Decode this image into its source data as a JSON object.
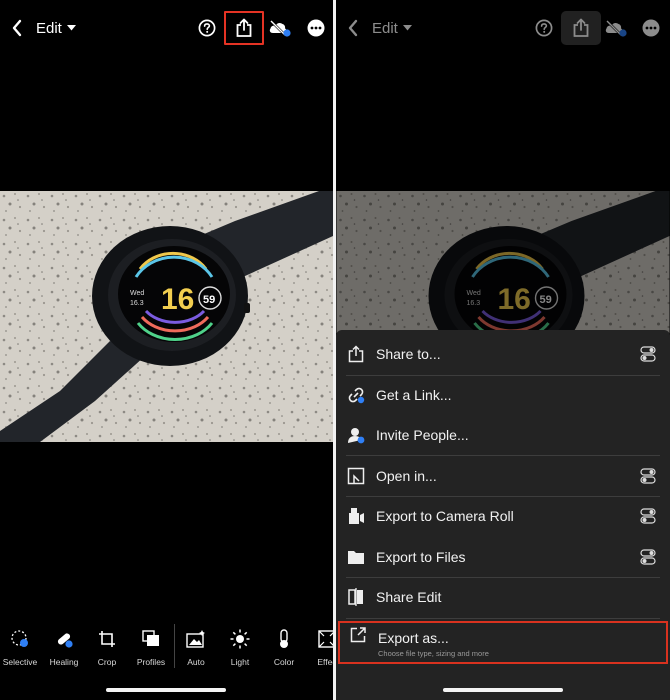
{
  "left_panel": {
    "topbar": {
      "edit_label": "Edit"
    },
    "watch": {
      "time_hour": "16",
      "time_badge": "59",
      "date_day": "Wed",
      "date_num": "16.3"
    },
    "tools": [
      {
        "label": "Selective",
        "icon": "selective-icon"
      },
      {
        "label": "Healing",
        "icon": "healing-icon"
      },
      {
        "label": "Crop",
        "icon": "crop-icon"
      },
      {
        "label": "Profiles",
        "icon": "profiles-icon"
      },
      {
        "label": "Auto",
        "icon": "auto-icon"
      },
      {
        "label": "Light",
        "icon": "light-icon"
      },
      {
        "label": "Color",
        "icon": "color-icon"
      },
      {
        "label": "Effec",
        "icon": "effects-icon"
      }
    ]
  },
  "right_panel": {
    "topbar": {
      "edit_label": "Edit"
    },
    "share_menu": [
      {
        "label": "Share to...",
        "icon": "share-icon",
        "has_toggle": true
      },
      {
        "label": "Get a Link...",
        "icon": "link-icon",
        "has_toggle": false
      },
      {
        "label": "Invite People...",
        "icon": "invite-icon",
        "has_toggle": false
      },
      {
        "label": "Open in...",
        "icon": "open-in-icon",
        "has_toggle": true
      },
      {
        "label": "Export to Camera Roll",
        "icon": "camera-roll-icon",
        "has_toggle": true
      },
      {
        "label": "Export to Files",
        "icon": "folder-icon",
        "has_toggle": true
      },
      {
        "label": "Share Edit",
        "icon": "share-edit-icon",
        "has_toggle": false
      },
      {
        "label": "Export as...",
        "sublabel": "Choose file type, sizing and more",
        "icon": "export-as-icon",
        "has_toggle": false
      }
    ]
  },
  "colors": {
    "highlight": "#e53324",
    "sheet_bg": "#232323",
    "accent_blue": "#2f7ff5"
  }
}
